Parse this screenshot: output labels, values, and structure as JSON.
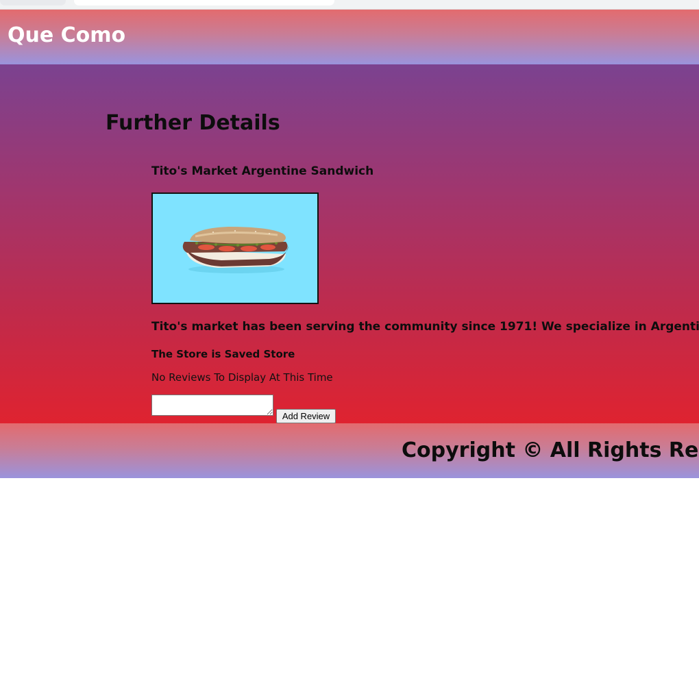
{
  "header": {
    "title": "Que Como"
  },
  "main": {
    "heading": "Further Details",
    "item": {
      "name": "Tito's Market Argentine Sandwich",
      "photo_alt": "Argentine sandwich",
      "description": "Tito's market has been serving the community since 1971! We specialize in Argentine and I",
      "store_status": "The Store is Saved Store"
    },
    "reviews": {
      "empty_message": "No Reviews To Display At This Time",
      "input_value": "",
      "button_label": "Add Review"
    }
  },
  "footer": {
    "text": "Copyright © All Rights Reser"
  }
}
